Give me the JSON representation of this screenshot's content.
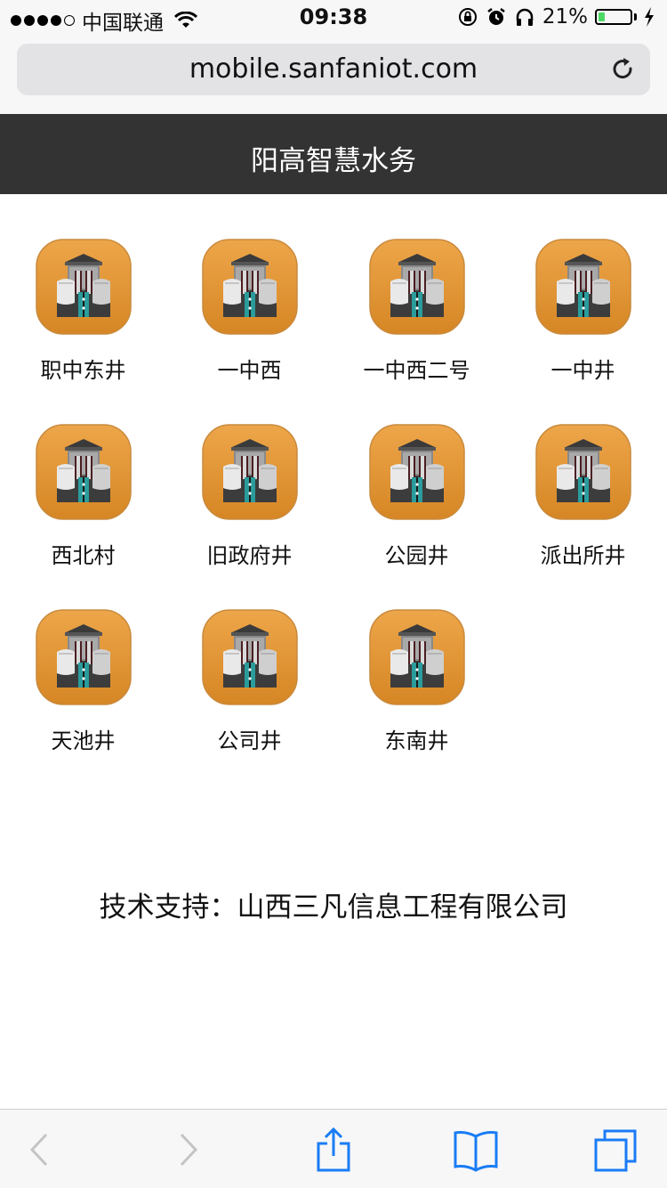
{
  "status_bar": {
    "carrier": "中国联通",
    "time": "09:38",
    "battery_percent": "21%",
    "battery_level": 0.21,
    "icons": [
      "wifi-icon",
      "orientation-lock-icon",
      "alarm-icon",
      "headphones-icon",
      "charging-icon"
    ]
  },
  "browser": {
    "url": "mobile.sanfaniot.com"
  },
  "header": {
    "title": "阳高智慧水务"
  },
  "wells": [
    {
      "label": "职中东井"
    },
    {
      "label": "一中西"
    },
    {
      "label": "一中西二号"
    },
    {
      "label": "一中井"
    },
    {
      "label": "西北村"
    },
    {
      "label": "旧政府井"
    },
    {
      "label": "公园井"
    },
    {
      "label": "派出所井"
    },
    {
      "label": "天池井"
    },
    {
      "label": "公司井"
    },
    {
      "label": "东南井"
    }
  ],
  "footer": {
    "support": "技术支持：山西三凡信息工程有限公司"
  },
  "toolbar": {
    "icons": [
      "back-icon",
      "forward-icon",
      "share-icon",
      "bookmarks-icon",
      "tabs-icon"
    ]
  },
  "colors": {
    "header_bg": "#333333",
    "icon_orange": "#e3962f",
    "accent_blue": "#1a7cf5"
  }
}
